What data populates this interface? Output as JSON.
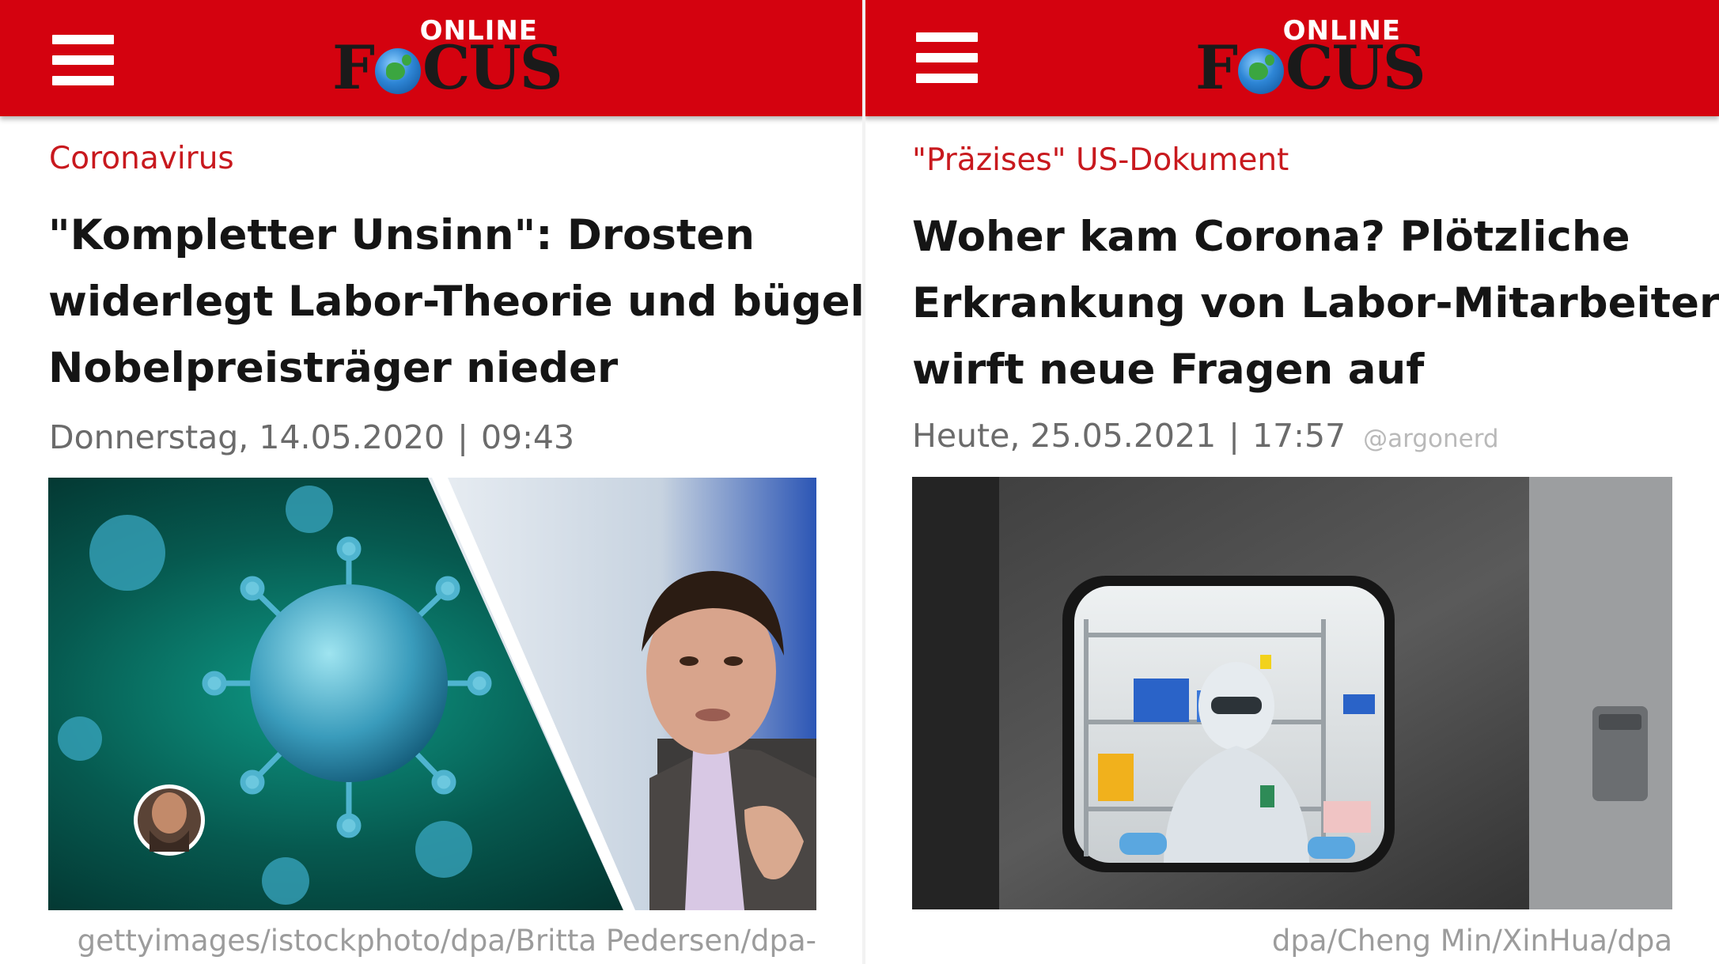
{
  "colors": {
    "brand_red": "#d4020f",
    "kicker_red": "#c8191e",
    "headline": "#151515",
    "meta_gray": "#6b6b6b"
  },
  "left": {
    "menu_icon": "hamburger-menu-icon",
    "logo": {
      "online": "ONLINE",
      "focus_pre": "F",
      "focus_post": "CUS",
      "globe_icon": "globe-icon"
    },
    "kicker": "Coronavirus",
    "headline": [
      "\"Kompletter Unsinn\": Drosten",
      "widerlegt Labor-Theorie und bügelt",
      "Nobelpreisträger nieder"
    ],
    "date": "Donnerstag, 14.05.2020",
    "separator": "|",
    "time": "09:43",
    "photo": {
      "description_icon": "coronavirus-and-scientist-photo",
      "avatar_icon": "author-avatar-icon"
    },
    "credit": "gettyimages/istockphoto/dpa/Britta Pedersen/dpa-"
  },
  "right": {
    "menu_icon": "hamburger-menu-icon",
    "logo": {
      "online": "ONLINE",
      "focus_pre": "F",
      "focus_post": "CUS",
      "globe_icon": "globe-icon"
    },
    "kicker": "\"Präzises\" US-Dokument",
    "headline": [
      "Woher kam Corona? Plötzliche",
      "Erkrankung von Labor-Mitarbeitern",
      "wirft neue Fragen auf"
    ],
    "date": "Heute, 25.05.2021",
    "separator": "|",
    "time": "17:57",
    "handle": "@argonerd",
    "photo": {
      "description_icon": "lab-worker-photo"
    },
    "credit": "dpa/Cheng Min/XinHua/dpa"
  }
}
